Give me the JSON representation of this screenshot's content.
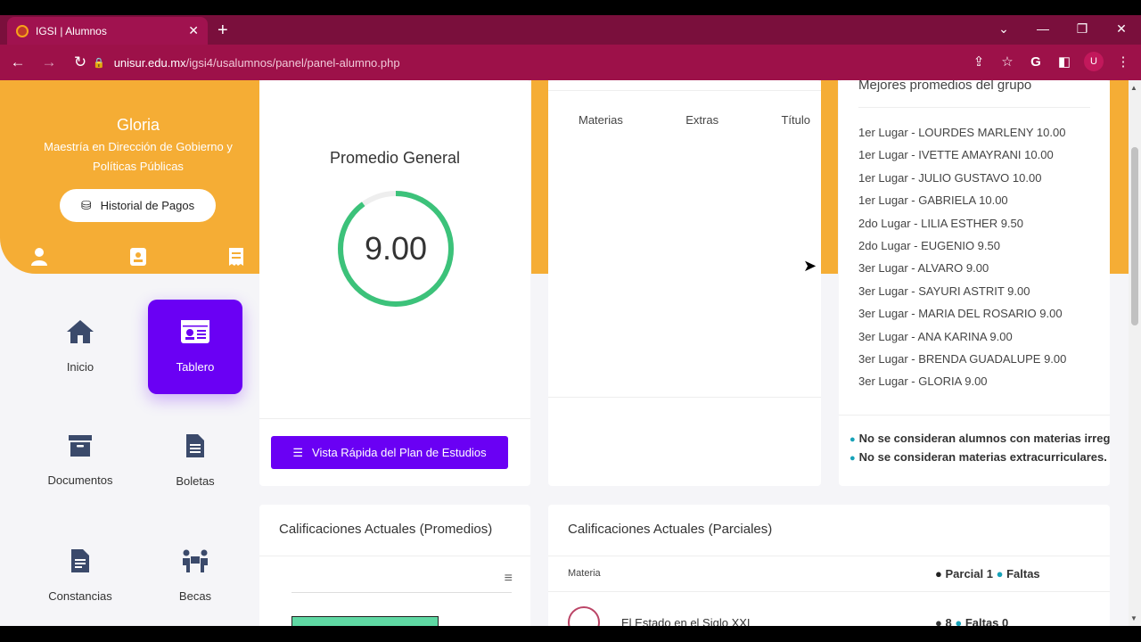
{
  "browser": {
    "tab_title": "IGSI | Alumnos",
    "url_host": "unisur.edu.mx",
    "url_path": "/igsi4/usalumnos/panel/panel-alumno.php",
    "profile_initial": "U"
  },
  "profile": {
    "name": "Gloria",
    "program": "Maestría en Dirección de Gobierno y Políticas Públicas",
    "payments_button": "Historial de Pagos"
  },
  "menu": {
    "inicio": "Inicio",
    "tablero": "Tablero",
    "documentos": "Documentos",
    "boletas": "Boletas",
    "constancias": "Constancias",
    "becas": "Becas"
  },
  "promedio": {
    "title": "Promedio General",
    "value": "9.00",
    "max_value": 10,
    "fraction": 0.9,
    "ring_color": "#3cc27a",
    "button": "Vista Rápida del Plan de Estudios"
  },
  "materias": {
    "col_materias": "Materias",
    "col_extras": "Extras",
    "col_titulo": "Título"
  },
  "mejores": {
    "title": "Mejores promedios del grupo",
    "rankings": [
      "1er Lugar - LOURDES MARLENY 10.00",
      "1er Lugar - IVETTE AMAYRANI 10.00",
      "1er Lugar - JULIO GUSTAVO 10.00",
      "1er Lugar - GABRIELA 10.00",
      "2do Lugar - LILIA ESTHER 9.50",
      "2do Lugar - EUGENIO 9.50",
      "3er Lugar - ALVARO 9.00",
      "3er Lugar - SAYURI ASTRIT 9.00",
      "3er Lugar - MARIA DEL ROSARIO 9.00",
      "3er Lugar - ANA KARINA 9.00",
      "3er Lugar - BRENDA GUADALUPE 9.00",
      "3er Lugar - GLORIA 9.00"
    ],
    "note1": "No se consideran alumnos con materias irregulares",
    "note2": "No se consideran materias extracurriculares."
  },
  "calif_promedios": {
    "title": "Calificaciones Actuales (Promedios)"
  },
  "calif_parciales": {
    "title": "Calificaciones Actuales (Parciales)",
    "col_materia": "Materia",
    "col_parcial": "Parcial 1",
    "col_faltas": "Faltas",
    "row_subject": "El Estado en el Siglo XXI",
    "row_grade": "8",
    "row_faltas": "Faltas 0"
  },
  "colors": {
    "accent_orange": "#f5ad35",
    "accent_purple": "#6a00f4",
    "browser_maroon": "#9d1149"
  }
}
